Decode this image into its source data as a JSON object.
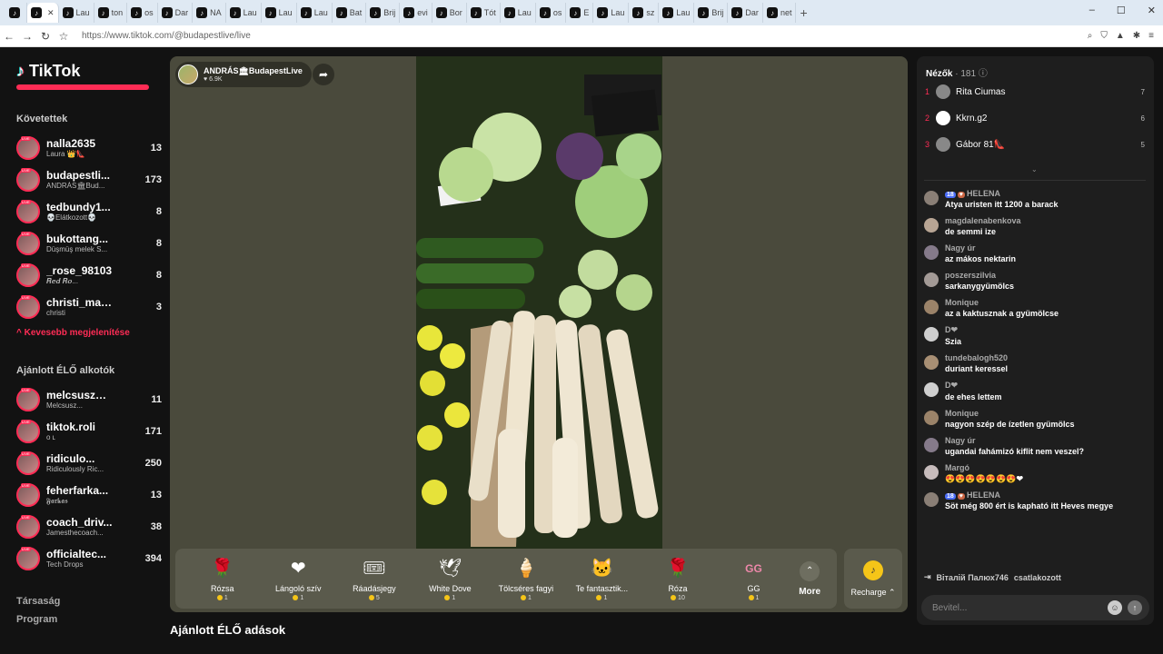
{
  "browser": {
    "tabs": [
      "",
      "",
      "Lau",
      "ton",
      "os",
      "Dar",
      "NA",
      "Lau",
      "Lau",
      "Lau",
      "Bat",
      "Brij",
      "evi",
      "Bor",
      "Tót",
      "Lau",
      "os",
      "E",
      "Lau",
      "sz",
      "Lau",
      "Brij",
      "Dar",
      "net"
    ],
    "url": "https://www.tiktok.com/@budapestlive/live"
  },
  "sidebar": {
    "logo": "TikTok",
    "following_title": "Követettek",
    "following": [
      {
        "name": "nalla2635",
        "sub": "Laura 👑👠",
        "count": "13"
      },
      {
        "name": "budapestli...",
        "sub": "ANDRÁS🏛Bud...",
        "count": "173"
      },
      {
        "name": "tedbundy1...",
        "sub": "💀Elátkozott💀",
        "count": "8"
      },
      {
        "name": "bukottang...",
        "sub": "Düşmüş melek S...",
        "count": "8"
      },
      {
        "name": "_rose_98103",
        "sub": "𝑹𝒆𝒅 𝑹𝒐...",
        "count": "8"
      },
      {
        "name": "christi_maxy",
        "sub": "christi",
        "count": "3"
      }
    ],
    "show_less": "Kevesebb megjelenítése",
    "suggested_title": "Ajánlott ÉLŐ alkotók",
    "suggested": [
      {
        "name": "melcsuszm...",
        "sub": "Melcsusz...",
        "count": "11"
      },
      {
        "name": "tiktok.roli",
        "sub": "ᴏ ʟ",
        "count": "171"
      },
      {
        "name": "ridiculo...",
        "sub": "Ridiculously Ric...",
        "count": "250"
      },
      {
        "name": "feherfarka...",
        "sub": "𝕱𝖆𝖗𝖐𝖆𝖘",
        "count": "13"
      },
      {
        "name": "coach_driv...",
        "sub": "Jamesthecoach...",
        "count": "38"
      },
      {
        "name": "officialtec...",
        "sub": "Tech Drops",
        "count": "394"
      }
    ],
    "footer": [
      "Társaság",
      "Program"
    ]
  },
  "live": {
    "host_name": "ANDRÁS🏛BudapestLive",
    "host_likes": "♥ 6.9K",
    "gifts": [
      {
        "name": "Rózsa",
        "price": "1",
        "icon": "🌹"
      },
      {
        "name": "Lángoló szív",
        "price": "1",
        "icon": "❤"
      },
      {
        "name": "Ráadásjegy",
        "price": "5",
        "icon": "🎟"
      },
      {
        "name": "White Dove",
        "price": "1",
        "icon": "🕊"
      },
      {
        "name": "Tölcséres fagyi",
        "price": "1",
        "icon": "🍦"
      },
      {
        "name": "Te fantasztik...",
        "price": "1",
        "icon": "🐱"
      },
      {
        "name": "Róza",
        "price": "10",
        "icon": "🌹"
      },
      {
        "name": "GG",
        "price": "1",
        "icon": "GG"
      }
    ],
    "more_label": "More",
    "recharge_label": "Recharge ⌃",
    "below_title": "Ajánlott ÉLŐ adások"
  },
  "panel": {
    "viewers_label": "Nézők",
    "viewers_count": "· 181",
    "top_viewers": [
      {
        "rank": "1",
        "name": "Rita Ciumas",
        "score": "7"
      },
      {
        "rank": "2",
        "name": "Kkrn.g2",
        "score": "6"
      },
      {
        "rank": "3",
        "name": "Gábor 81👠",
        "score": "5"
      }
    ],
    "chat": [
      {
        "name": "HELENA",
        "badge": "18",
        "text": "Atya uristen itt 1200 a barack"
      },
      {
        "name": "magdalenabenkova",
        "text": "de semmi ize"
      },
      {
        "name": "Nagy úr",
        "text": "az mákos nektarin"
      },
      {
        "name": "poszerszilvia",
        "text": "sarkanygyümölcs"
      },
      {
        "name": "Monique",
        "text": "az a kaktusznak a gyümölcse"
      },
      {
        "name": "D❤",
        "text": "Szia"
      },
      {
        "name": "tundebalogh520",
        "text": "duriant keressel"
      },
      {
        "name": "D❤",
        "text": "de ehes lettem"
      },
      {
        "name": "Monique",
        "text": "nagyon szép de ízetlen gyümölcs"
      },
      {
        "name": "Nagy úr",
        "text": "ugandai fahámizó kiflit nem veszel?"
      },
      {
        "name": "Margó",
        "text": "😍😍😍😍😍😍😍❤"
      },
      {
        "name": "HELENA",
        "badge": "18",
        "text": "Söt még 800 ért is kapható itt Heves megye"
      }
    ],
    "join_name": "Віталій Палюх746",
    "join_text": "csatlakozott",
    "input_placeholder": "Bevitel..."
  }
}
